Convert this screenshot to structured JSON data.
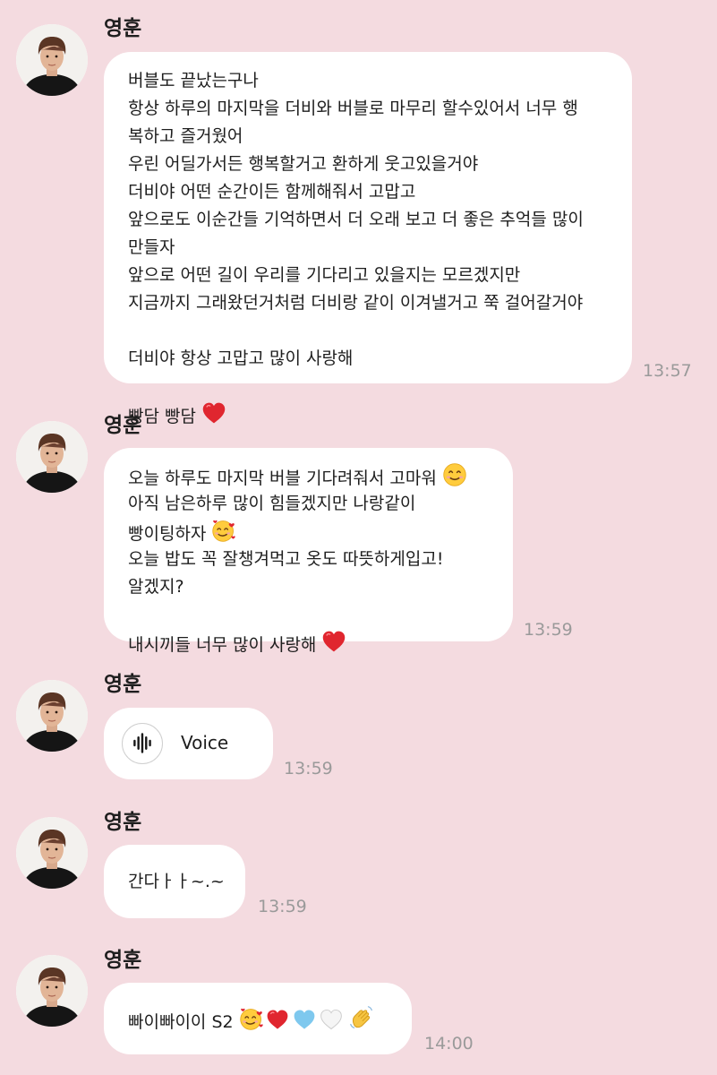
{
  "messages": [
    {
      "sender": "영훈",
      "lines": [
        "버블도 끝났는구나",
        "항상 하루의 마지막을 더비와 버블로 마무리 할수있어서 너무 행",
        "복하고 즐거웠어",
        "우린 어딜가서든 행복할거고 환하게 웃고있을거야",
        "더비야 어떤 순간이든 함께해줘서 고맙고",
        "앞으로도 이순간들 기억하면서 더 오래 보고 더 좋은 추억들 많이",
        "만들자",
        "앞으로 어떤 길이 우리를 기다리고 있을지는 모르겠지만",
        "지금까지 그래왔던거처럼 더비랑 같이 이겨낼거고 쭉 걸어갈거야",
        "",
        "더비야 항상 고맙고 많이 사랑해",
        "",
        "빵담 빵담"
      ],
      "time": "13:57"
    },
    {
      "sender": "영훈",
      "lines": [
        "오늘 하루도 마지막 버블 기다려줘서 고마워",
        "아직 남은하루 많이 힘들겠지만 나랑같이",
        "빵이팅하자",
        "오늘 밥도 꼭 잘챙겨먹고 옷도 따뜻하게입고!",
        "알겠지?",
        "",
        "내시끼들 너무 많이 사랑해"
      ],
      "time": "13:59"
    },
    {
      "sender": "영훈",
      "voice_label": "Voice",
      "time": "13:59"
    },
    {
      "sender": "영훈",
      "lines": [
        "간다ㅏㅏ~.~"
      ],
      "time": "13:59"
    },
    {
      "sender": "영훈",
      "lines": [
        "빠이빠이이 S2"
      ],
      "time": "14:00"
    }
  ],
  "icons": {
    "heart": "red-heart-icon",
    "smile": "smiling-face-icon",
    "hearts_face": "smiling-face-with-hearts-icon",
    "blue_heart": "blue-heart-icon",
    "white_heart": "white-heart-icon",
    "wave": "waving-hand-icon",
    "voice": "audio-waveform-icon"
  },
  "colors": {
    "background": "#f4dbe0",
    "bubble": "#ffffff",
    "time": "#9a9a9a",
    "heart_red": "#e0262f",
    "heart_blue": "#7ec8ee"
  }
}
